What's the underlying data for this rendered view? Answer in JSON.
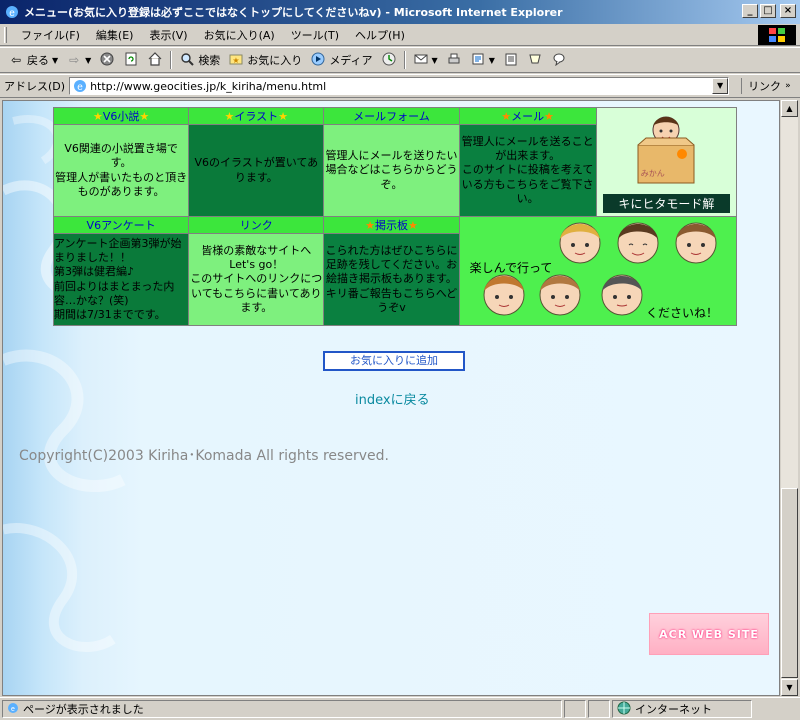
{
  "window": {
    "title": "メニュー(お気に入り登録は必ずここではなくトップにしてくださいねv) - Microsoft Internet Explorer",
    "minimize": "_",
    "maximize": "□",
    "close": "×"
  },
  "menubar": {
    "items": [
      "ファイル(F)",
      "編集(E)",
      "表示(V)",
      "お気に入り(A)",
      "ツール(T)",
      "ヘルプ(H)"
    ]
  },
  "toolbar": {
    "back": "戻る",
    "search": "検索",
    "favorites": "お気に入り",
    "media": "メディア"
  },
  "address": {
    "label": "アドレス(D)",
    "url": "http://www.geocities.jp/k_kiriha/menu.html",
    "links": "リンク"
  },
  "menu_table": {
    "row1": {
      "novel": {
        "title": "V6小説",
        "desc": "V6関連の小説置き場です。\n管理人が書いたものと頂きものがあります。"
      },
      "illust": {
        "title": "イラスト",
        "desc": "V6のイラストが置いてあります。"
      },
      "mailform": {
        "title": "メールフォーム",
        "desc": "管理人にメールを送りたい場合などはこちらからどうぞ。"
      },
      "mail": {
        "title": "メール",
        "desc": "管理人にメールを送ることが出来ます。\nこのサイトに投稿を考えている方もこちらをご覧下さい。"
      },
      "corner": {
        "sign_text": "みかん",
        "marquee": "キにヒタモード解"
      }
    },
    "row2": {
      "survey": {
        "title": "V6アンケート",
        "desc": "アンケート企画第3弾が始まりました！！\n第3弾は健君編♪\n前回よりはまとまった内容…かな？(笑)\n期間は7/31までです。"
      },
      "link": {
        "title": "リンク",
        "desc": "皆様の素敵なサイトへLet's go！\nこのサイトへのリンクについてもこちらに書いてあります。"
      },
      "bbs": {
        "title": "掲示板",
        "desc": "こられた方はぜひこちらに足跡を残してください。お絵描き掲示板もあります。\nキリ番ご報告もこちらへどうぞv"
      },
      "faces": {
        "text_left": "楽しんで行って",
        "text_right": "くださいね！"
      }
    }
  },
  "buttons": {
    "add_favorite": "お気に入りに追加"
  },
  "links": {
    "back_index": "indexに戻る"
  },
  "copyright": "Copyright(C)2003 Kiriha･Komada All rights reserved.",
  "banner": "ACR WEB SITE",
  "statusbar": {
    "message": "ページが表示されました",
    "zone": "インターネット"
  }
}
